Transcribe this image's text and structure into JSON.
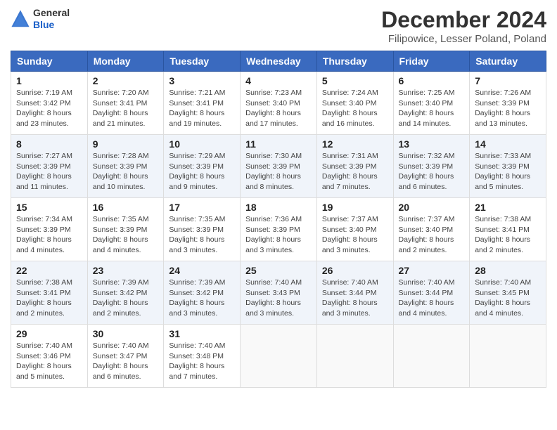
{
  "header": {
    "logo_line1": "General",
    "logo_line2": "Blue",
    "month_title": "December 2024",
    "location": "Filipowice, Lesser Poland, Poland"
  },
  "days_of_week": [
    "Sunday",
    "Monday",
    "Tuesday",
    "Wednesday",
    "Thursday",
    "Friday",
    "Saturday"
  ],
  "weeks": [
    [
      {
        "day": "1",
        "sunrise": "7:19 AM",
        "sunset": "3:42 PM",
        "daylight": "8 hours and 23 minutes."
      },
      {
        "day": "2",
        "sunrise": "7:20 AM",
        "sunset": "3:41 PM",
        "daylight": "8 hours and 21 minutes."
      },
      {
        "day": "3",
        "sunrise": "7:21 AM",
        "sunset": "3:41 PM",
        "daylight": "8 hours and 19 minutes."
      },
      {
        "day": "4",
        "sunrise": "7:23 AM",
        "sunset": "3:40 PM",
        "daylight": "8 hours and 17 minutes."
      },
      {
        "day": "5",
        "sunrise": "7:24 AM",
        "sunset": "3:40 PM",
        "daylight": "8 hours and 16 minutes."
      },
      {
        "day": "6",
        "sunrise": "7:25 AM",
        "sunset": "3:40 PM",
        "daylight": "8 hours and 14 minutes."
      },
      {
        "day": "7",
        "sunrise": "7:26 AM",
        "sunset": "3:39 PM",
        "daylight": "8 hours and 13 minutes."
      }
    ],
    [
      {
        "day": "8",
        "sunrise": "7:27 AM",
        "sunset": "3:39 PM",
        "daylight": "8 hours and 11 minutes."
      },
      {
        "day": "9",
        "sunrise": "7:28 AM",
        "sunset": "3:39 PM",
        "daylight": "8 hours and 10 minutes."
      },
      {
        "day": "10",
        "sunrise": "7:29 AM",
        "sunset": "3:39 PM",
        "daylight": "8 hours and 9 minutes."
      },
      {
        "day": "11",
        "sunrise": "7:30 AM",
        "sunset": "3:39 PM",
        "daylight": "8 hours and 8 minutes."
      },
      {
        "day": "12",
        "sunrise": "7:31 AM",
        "sunset": "3:39 PM",
        "daylight": "8 hours and 7 minutes."
      },
      {
        "day": "13",
        "sunrise": "7:32 AM",
        "sunset": "3:39 PM",
        "daylight": "8 hours and 6 minutes."
      },
      {
        "day": "14",
        "sunrise": "7:33 AM",
        "sunset": "3:39 PM",
        "daylight": "8 hours and 5 minutes."
      }
    ],
    [
      {
        "day": "15",
        "sunrise": "7:34 AM",
        "sunset": "3:39 PM",
        "daylight": "8 hours and 4 minutes."
      },
      {
        "day": "16",
        "sunrise": "7:35 AM",
        "sunset": "3:39 PM",
        "daylight": "8 hours and 4 minutes."
      },
      {
        "day": "17",
        "sunrise": "7:35 AM",
        "sunset": "3:39 PM",
        "daylight": "8 hours and 3 minutes."
      },
      {
        "day": "18",
        "sunrise": "7:36 AM",
        "sunset": "3:39 PM",
        "daylight": "8 hours and 3 minutes."
      },
      {
        "day": "19",
        "sunrise": "7:37 AM",
        "sunset": "3:40 PM",
        "daylight": "8 hours and 3 minutes."
      },
      {
        "day": "20",
        "sunrise": "7:37 AM",
        "sunset": "3:40 PM",
        "daylight": "8 hours and 2 minutes."
      },
      {
        "day": "21",
        "sunrise": "7:38 AM",
        "sunset": "3:41 PM",
        "daylight": "8 hours and 2 minutes."
      }
    ],
    [
      {
        "day": "22",
        "sunrise": "7:38 AM",
        "sunset": "3:41 PM",
        "daylight": "8 hours and 2 minutes."
      },
      {
        "day": "23",
        "sunrise": "7:39 AM",
        "sunset": "3:42 PM",
        "daylight": "8 hours and 2 minutes."
      },
      {
        "day": "24",
        "sunrise": "7:39 AM",
        "sunset": "3:42 PM",
        "daylight": "8 hours and 3 minutes."
      },
      {
        "day": "25",
        "sunrise": "7:40 AM",
        "sunset": "3:43 PM",
        "daylight": "8 hours and 3 minutes."
      },
      {
        "day": "26",
        "sunrise": "7:40 AM",
        "sunset": "3:44 PM",
        "daylight": "8 hours and 3 minutes."
      },
      {
        "day": "27",
        "sunrise": "7:40 AM",
        "sunset": "3:44 PM",
        "daylight": "8 hours and 4 minutes."
      },
      {
        "day": "28",
        "sunrise": "7:40 AM",
        "sunset": "3:45 PM",
        "daylight": "8 hours and 4 minutes."
      }
    ],
    [
      {
        "day": "29",
        "sunrise": "7:40 AM",
        "sunset": "3:46 PM",
        "daylight": "8 hours and 5 minutes."
      },
      {
        "day": "30",
        "sunrise": "7:40 AM",
        "sunset": "3:47 PM",
        "daylight": "8 hours and 6 minutes."
      },
      {
        "day": "31",
        "sunrise": "7:40 AM",
        "sunset": "3:48 PM",
        "daylight": "8 hours and 7 minutes."
      },
      null,
      null,
      null,
      null
    ]
  ]
}
